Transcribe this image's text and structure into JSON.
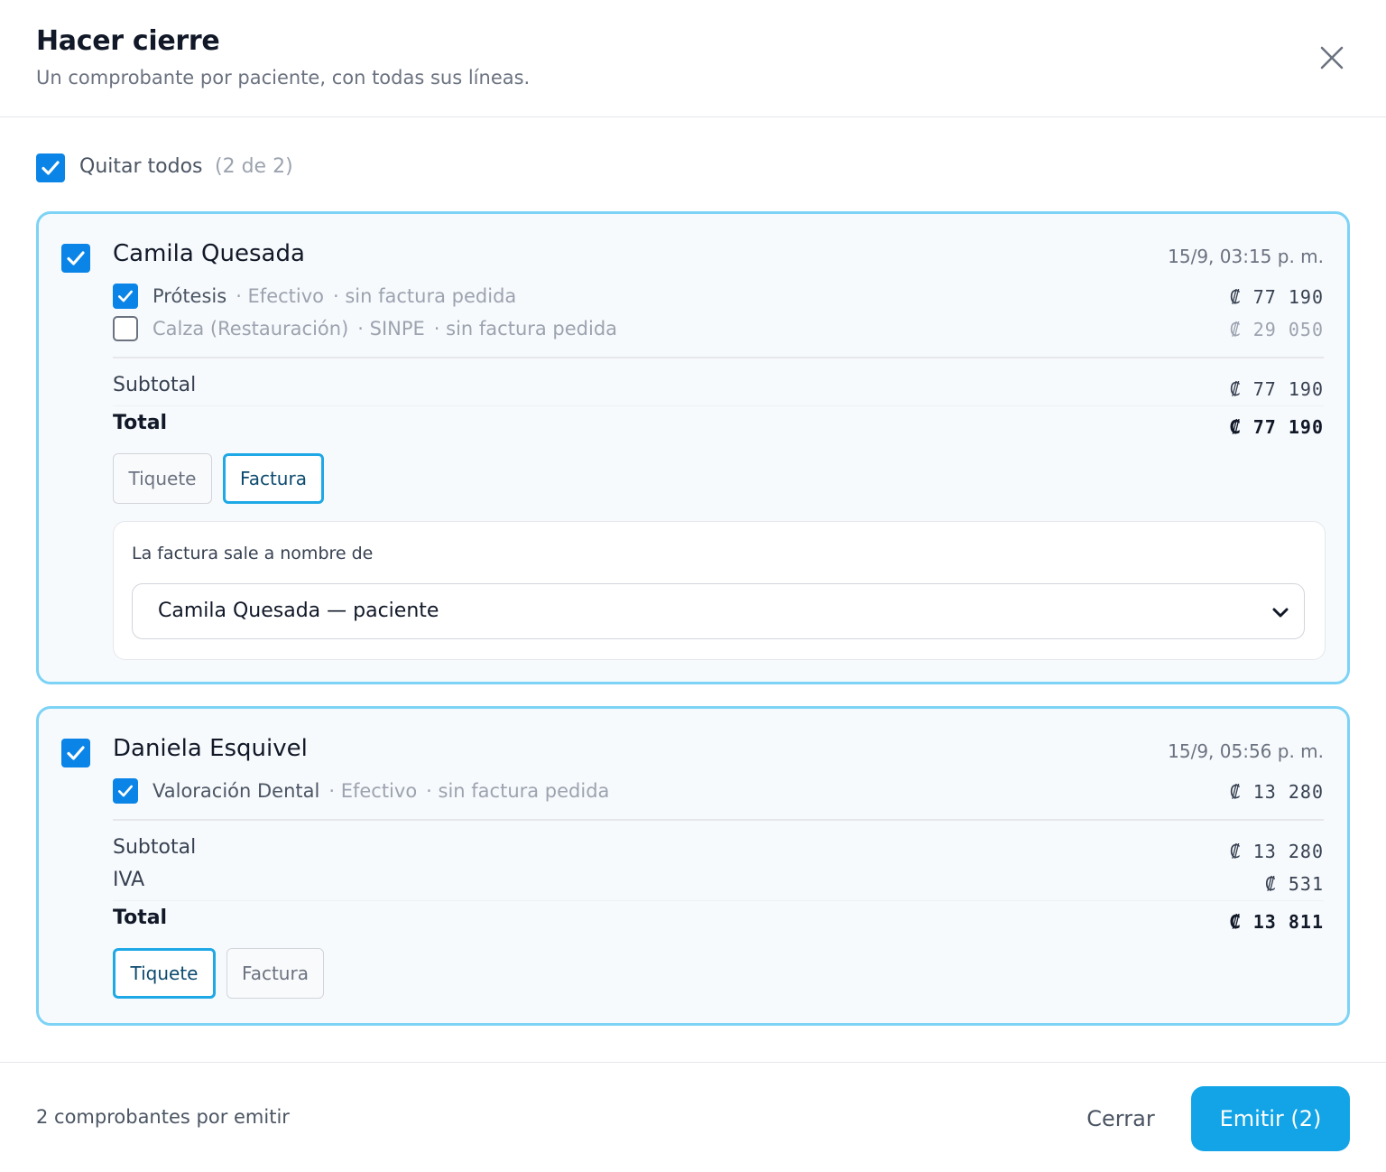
{
  "header": {
    "title": "Hacer cierre",
    "subtitle": "Un comprobante por paciente, con todas sus líneas."
  },
  "select_all": {
    "checked": true,
    "label": "Quitar todos",
    "count": "(2 de 2)"
  },
  "patients": [
    {
      "checked": true,
      "name": "Camila Quesada",
      "datetime": "15/9, 03:15 p. m.",
      "lines": [
        {
          "checked": true,
          "name": "Prótesis",
          "method": "· Efectivo",
          "status": "· sin factura pedida",
          "amount": "₡ 77 190"
        },
        {
          "checked": false,
          "name": "Calza (Restauración)",
          "method": "· SINPE",
          "status": "· sin factura pedida",
          "amount": "₡ 29 050"
        }
      ],
      "subtotal_label": "Subtotal",
      "subtotal": "₡ 77 190",
      "total_label": "Total",
      "total": "₡ 77 190",
      "doc_types": [
        "Tiquete",
        "Factura"
      ],
      "selected_doc_type": "Factura",
      "invoice": {
        "label": "La factura sale a nombre de",
        "selected": "Camila Quesada — paciente"
      }
    },
    {
      "checked": true,
      "name": "Daniela Esquivel",
      "datetime": "15/9, 05:56 p. m.",
      "lines": [
        {
          "checked": true,
          "name": "Valoración Dental",
          "method": "· Efectivo",
          "status": "· sin factura pedida",
          "amount": "₡ 13 280"
        }
      ],
      "subtotal_label": "Subtotal",
      "subtotal": "₡ 13 280",
      "tax_label": "IVA",
      "tax": "₡ 531",
      "total_label": "Total",
      "total": "₡ 13 811",
      "doc_types": [
        "Tiquete",
        "Factura"
      ],
      "selected_doc_type": "Tiquete"
    }
  ],
  "footer": {
    "status": "2 comprobantes por emitir",
    "close_label": "Cerrar",
    "emit_label": "Emitir (2)"
  },
  "colors": {
    "accent": "#0a84e6",
    "card_border": "#7dd3f5",
    "primary_button": "#12a4e6"
  }
}
